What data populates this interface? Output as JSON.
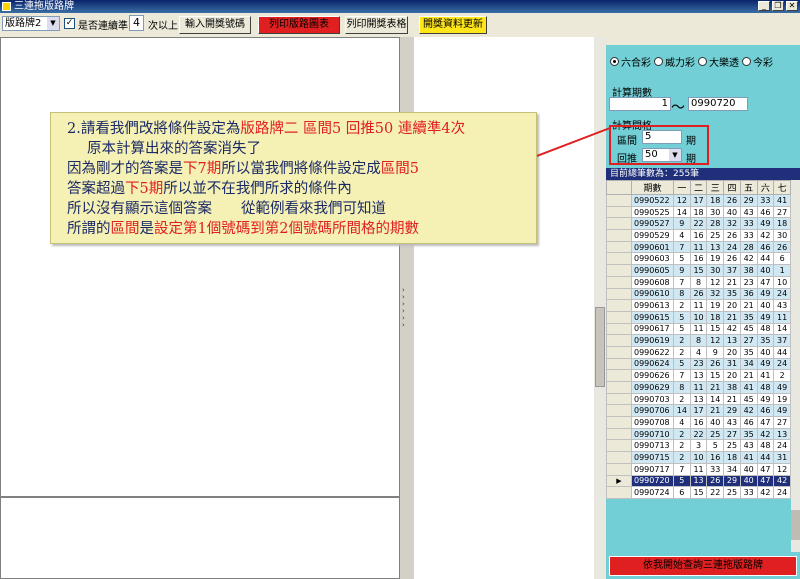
{
  "window": {
    "title": "三連拖版路牌"
  },
  "toolbar": {
    "mode_select": "版路牌2",
    "check_label": "是否連續準",
    "streak_value": "4",
    "streak_suffix": "次以上",
    "btn_input": "輸入開獎號碼",
    "btn_print_chart": "列印版路圖表",
    "btn_print_table": "列印開獎表格",
    "btn_update": "開獎資料更新"
  },
  "right": {
    "radios": [
      "六合彩",
      "威力彩",
      "大樂透",
      "今彩"
    ],
    "period_group": "計算期數",
    "period_from": "1",
    "period_to": "0990720",
    "calc_group": "計算間格",
    "interval_label": "區間",
    "interval_value": "5",
    "push_label": "回推",
    "push_value": "50",
    "unit": "期",
    "total_label": "目前總筆數為：255筆",
    "bottom_button": "依我開始查詢三連拖版路牌"
  },
  "table": {
    "headers": [
      "期數",
      "一",
      "二",
      "三",
      "四",
      "五",
      "六",
      "七"
    ],
    "rows": [
      [
        "0990522",
        "12",
        "17",
        "18",
        "26",
        "29",
        "33",
        "41"
      ],
      [
        "0990525",
        "14",
        "18",
        "30",
        "40",
        "43",
        "46",
        "27"
      ],
      [
        "0990527",
        "9",
        "22",
        "28",
        "32",
        "33",
        "49",
        "18"
      ],
      [
        "0990529",
        "4",
        "16",
        "25",
        "26",
        "33",
        "42",
        "30"
      ],
      [
        "0990601",
        "7",
        "11",
        "13",
        "24",
        "28",
        "46",
        "26"
      ],
      [
        "0990603",
        "5",
        "16",
        "19",
        "26",
        "42",
        "44",
        "6"
      ],
      [
        "0990605",
        "9",
        "15",
        "30",
        "37",
        "38",
        "40",
        "1"
      ],
      [
        "0990608",
        "7",
        "8",
        "12",
        "21",
        "23",
        "47",
        "10"
      ],
      [
        "0990610",
        "8",
        "26",
        "32",
        "35",
        "36",
        "49",
        "24"
      ],
      [
        "0990613",
        "2",
        "11",
        "19",
        "20",
        "21",
        "40",
        "43"
      ],
      [
        "0990615",
        "5",
        "10",
        "18",
        "21",
        "35",
        "49",
        "11"
      ],
      [
        "0990617",
        "5",
        "11",
        "15",
        "42",
        "45",
        "48",
        "14"
      ],
      [
        "0990619",
        "2",
        "8",
        "12",
        "13",
        "27",
        "35",
        "37"
      ],
      [
        "0990622",
        "2",
        "4",
        "9",
        "20",
        "35",
        "40",
        "44"
      ],
      [
        "0990624",
        "5",
        "23",
        "26",
        "31",
        "34",
        "49",
        "24"
      ],
      [
        "0990626",
        "7",
        "13",
        "15",
        "20",
        "21",
        "41",
        "2"
      ],
      [
        "0990629",
        "8",
        "11",
        "21",
        "38",
        "41",
        "48",
        "49"
      ],
      [
        "0990703",
        "2",
        "13",
        "14",
        "21",
        "45",
        "49",
        "19"
      ],
      [
        "0990706",
        "14",
        "17",
        "21",
        "29",
        "42",
        "46",
        "49"
      ],
      [
        "0990708",
        "4",
        "16",
        "40",
        "43",
        "46",
        "47",
        "27"
      ],
      [
        "0990710",
        "2",
        "22",
        "25",
        "27",
        "35",
        "42",
        "13"
      ],
      [
        "0990713",
        "2",
        "3",
        "5",
        "25",
        "43",
        "48",
        "24"
      ],
      [
        "0990715",
        "2",
        "10",
        "16",
        "18",
        "41",
        "44",
        "31"
      ],
      [
        "0990717",
        "7",
        "11",
        "33",
        "34",
        "40",
        "47",
        "12"
      ],
      [
        "0990720",
        "5",
        "13",
        "26",
        "29",
        "40",
        "47",
        "42"
      ],
      [
        "0990724",
        "6",
        "15",
        "22",
        "25",
        "33",
        "42",
        "24"
      ]
    ]
  },
  "note": {
    "l1a": "2.請看我們改將條件設定為",
    "l1b": "版路牌二 區間5 回推50 連續準4次",
    "l2": "原本計算出來的答案消失了",
    "l3a": "因為剛才的答案是",
    "l3b": "下7期",
    "l3c": "所以當我們將條件設定成",
    "l3d": "區間5",
    "l4a": "答案超過",
    "l4b": "下5期",
    "l4c": "所以並不在我們所求的條件內",
    "l5": "所以沒有顯示這個答案　　從範例看來我們可知道",
    "l6a": "所謂的",
    "l6b": "區間",
    "l6c": "是",
    "l6d": "設定第1個號碼到第2個號碼所間格的期數"
  },
  "colors": {
    "panel": "#72cfd5",
    "accent_red": "#e02020",
    "grid_header": "#1f2f7a",
    "note_bg": "#f5f0b4"
  }
}
